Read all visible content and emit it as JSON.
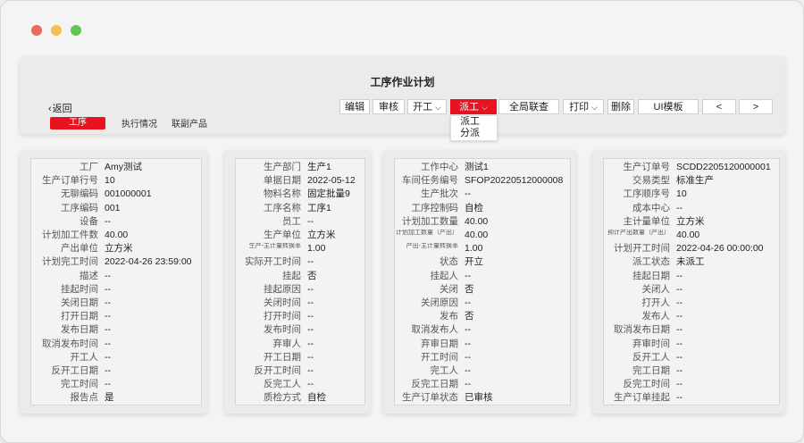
{
  "header": {
    "title": "工序作业计划",
    "back_label": "返回",
    "tabs": [
      {
        "label": "工序",
        "active": true
      },
      {
        "label": "执行情况",
        "active": false
      },
      {
        "label": "联副产品",
        "active": false
      }
    ]
  },
  "toolbar": {
    "edit": "编辑",
    "review": "审核",
    "start": "开工",
    "dispatch": "派工",
    "global_query": "全局联查",
    "print": "打印",
    "delete": "删除",
    "ui_template": "UI模板",
    "prev": "<",
    "next": ">"
  },
  "dispatch_menu": [
    "派工",
    "分派"
  ],
  "accent_color": "#e8131f",
  "cards": [
    {
      "rows": [
        {
          "label": "工厂",
          "value": "Amy测试"
        },
        {
          "label": "生产订单行号",
          "value": "10"
        },
        {
          "label": "无聊编码",
          "value": "001000001"
        },
        {
          "label": "工序编码",
          "value": "001"
        },
        {
          "label": "设备",
          "value": "--"
        },
        {
          "label": "计划加工件数",
          "value": "40.00"
        },
        {
          "label": "产出单位",
          "value": "立方米"
        },
        {
          "label": "计划完工时间",
          "value": "2022-04-26  23:59:00"
        },
        {
          "label": "描述",
          "value": "--"
        },
        {
          "label": "挂起时间",
          "value": "--"
        },
        {
          "label": "关闭日期",
          "value": "--"
        },
        {
          "label": "打开日期",
          "value": "--"
        },
        {
          "label": "发布日期",
          "value": "--"
        },
        {
          "label": "取消发布时间",
          "value": "--"
        },
        {
          "label": "开工人",
          "value": "--"
        },
        {
          "label": "反开工日期",
          "value": "--"
        },
        {
          "label": "完工时间",
          "value": "--"
        },
        {
          "label": "报告点",
          "value": "是"
        }
      ]
    },
    {
      "rows": [
        {
          "label": "生产部门",
          "value": "生产1"
        },
        {
          "label": "单据日期",
          "value": "2022-05-12"
        },
        {
          "label": "物料名称",
          "value": "固定批量9"
        },
        {
          "label": "工序名称",
          "value": "工序1"
        },
        {
          "label": "员工",
          "value": "--"
        },
        {
          "label": "生产单位",
          "value": "立方米"
        },
        {
          "label": "生产-主计量转换率",
          "value": "1.00",
          "small": true
        },
        {
          "label": "实际开工时间",
          "value": "--"
        },
        {
          "label": "挂起",
          "value": "否"
        },
        {
          "label": "挂起原因",
          "value": "--"
        },
        {
          "label": "关闭时间",
          "value": "--"
        },
        {
          "label": "打开时间",
          "value": "--"
        },
        {
          "label": "发布时间",
          "value": "--"
        },
        {
          "label": "弃审人",
          "value": "--"
        },
        {
          "label": "开工日期",
          "value": "--"
        },
        {
          "label": "反开工时间",
          "value": "--"
        },
        {
          "label": "反完工人",
          "value": "--"
        },
        {
          "label": "质检方式",
          "value": "自检"
        }
      ]
    },
    {
      "rows": [
        {
          "label": "工作中心",
          "value": "测试1"
        },
        {
          "label": "车间任务编号",
          "value": "SFOP20220512000008"
        },
        {
          "label": "生产批次",
          "value": "--"
        },
        {
          "label": "工序控制码",
          "value": "自检"
        },
        {
          "label": "计划加工数量",
          "value": "40.00"
        },
        {
          "label": "计划加工数量（产出）",
          "value": "40.00",
          "small": true
        },
        {
          "label": "产出-主计量转换率",
          "value": "1.00",
          "small": true
        },
        {
          "label": "状态",
          "value": "开立"
        },
        {
          "label": "挂起人",
          "value": "--"
        },
        {
          "label": "关闭",
          "value": "否"
        },
        {
          "label": "关闭原因",
          "value": "--"
        },
        {
          "label": "发布",
          "value": "否"
        },
        {
          "label": "取消发布人",
          "value": "--"
        },
        {
          "label": "弃审日期",
          "value": "--"
        },
        {
          "label": "开工时间",
          "value": "--"
        },
        {
          "label": "完工人",
          "value": "--"
        },
        {
          "label": "反完工日期",
          "value": "--"
        },
        {
          "label": "生产订单状态",
          "value": "已审核"
        }
      ]
    },
    {
      "rows": [
        {
          "label": "生产订单号",
          "value": "SCDD2205120000001"
        },
        {
          "label": "交易类型",
          "value": "标准生产"
        },
        {
          "label": "工序顺序号",
          "value": "10"
        },
        {
          "label": "成本中心",
          "value": "--"
        },
        {
          "label": "主计量单位",
          "value": "立方米"
        },
        {
          "label": "预计产出数量（产出）",
          "value": "40.00",
          "small": true
        },
        {
          "label": "计划开工时间",
          "value": "2022-04-26  00:00:00"
        },
        {
          "label": "派工状态",
          "value": "未派工"
        },
        {
          "label": "挂起日期",
          "value": "--"
        },
        {
          "label": "关闭人",
          "value": "--"
        },
        {
          "label": "打开人",
          "value": "--"
        },
        {
          "label": "发布人",
          "value": "--"
        },
        {
          "label": "取消发布日期",
          "value": "--"
        },
        {
          "label": "弃审时间",
          "value": "--"
        },
        {
          "label": "反开工人",
          "value": "--"
        },
        {
          "label": "完工日期",
          "value": "--"
        },
        {
          "label": "反完工时间",
          "value": "--"
        },
        {
          "label": "生产订单挂起",
          "value": "--"
        }
      ]
    }
  ]
}
